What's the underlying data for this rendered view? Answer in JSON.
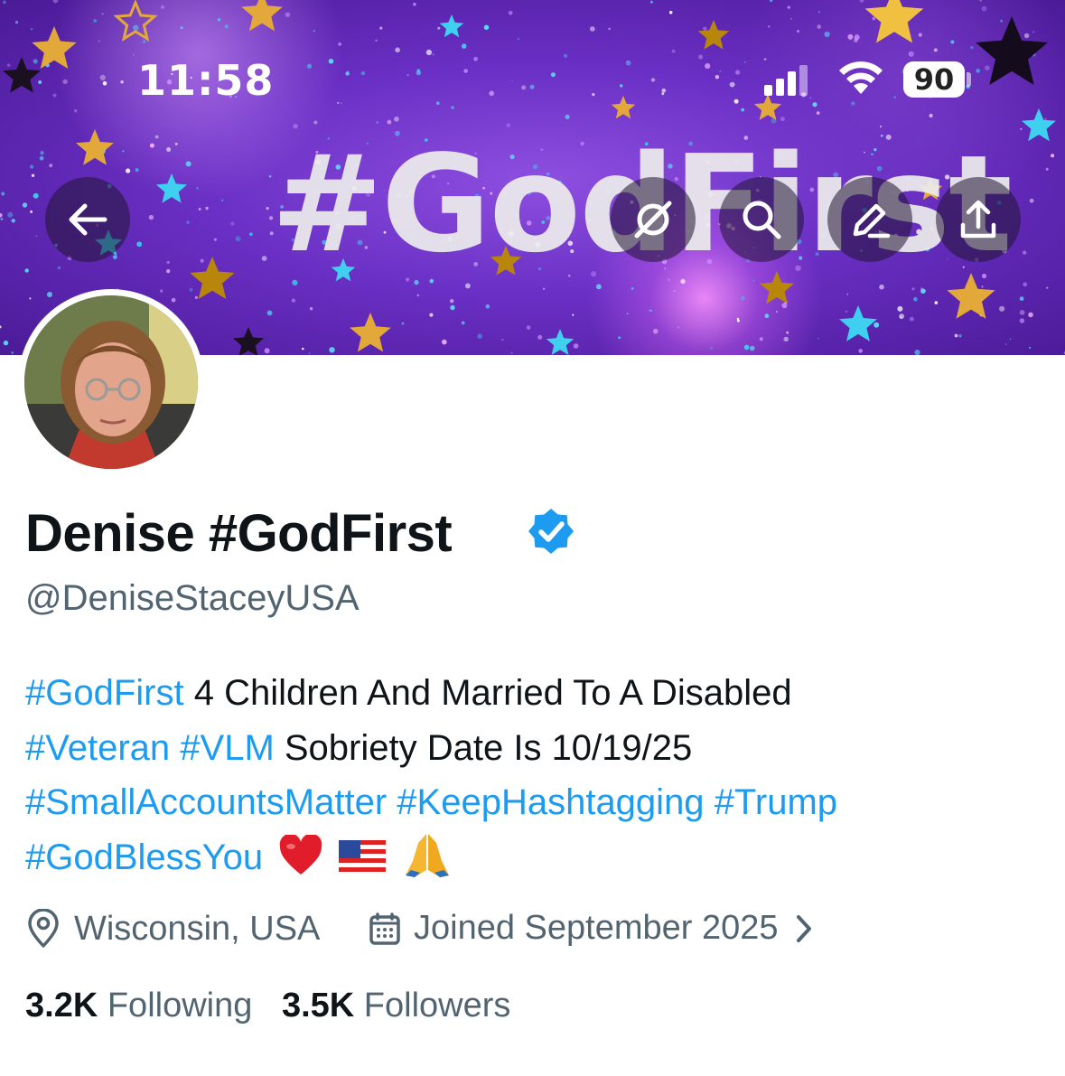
{
  "status_bar": {
    "time": "11:58",
    "battery": "90",
    "icons": [
      "cellular-signal-icon",
      "wifi-icon",
      "battery-icon"
    ]
  },
  "banner": {
    "text": "#GodFirst",
    "colors": {
      "base": "#6a2fc4",
      "highlight": "#e98cff",
      "star_gold": "#e2a93a",
      "star_cyan": "#39c6ea"
    }
  },
  "header_buttons": {
    "icons": [
      "back-arrow-icon",
      "grok-icon",
      "search-icon",
      "edit-icon",
      "share-icon"
    ]
  },
  "profile": {
    "display_name": "Denise #GodFirst",
    "verified": true,
    "handle": "@DeniseStaceyUSA",
    "bio": [
      [
        {
          "text": "#GodFirst",
          "tag": true
        },
        {
          "text": " 4 Children And Married To A Disabled",
          "tag": false
        }
      ],
      [
        {
          "text": "#Veteran",
          "tag": true
        },
        {
          "text": " ",
          "tag": false
        },
        {
          "text": "#VLM",
          "tag": true
        },
        {
          "text": " Sobriety Date Is 10/19/25",
          "tag": false
        }
      ],
      [
        {
          "text": "#SmallAccountsMatter",
          "tag": true
        },
        {
          "text": " ",
          "tag": false
        },
        {
          "text": "#KeepHashtagging",
          "tag": true
        },
        {
          "text": " ",
          "tag": false
        },
        {
          "text": "#Trump",
          "tag": true
        }
      ],
      [
        {
          "text": "#GodBlessYou",
          "tag": true
        }
      ]
    ],
    "bio_emojis": [
      "red-heart-emoji",
      "us-flag-emoji",
      "praying-hands-emoji"
    ],
    "location": "Wisconsin, USA",
    "joined": "Joined September 2025",
    "following_count": "3.2K",
    "following_label": "Following",
    "followers_count": "3.5K",
    "followers_label": "Followers"
  },
  "colors": {
    "link": "#1d9bf0",
    "text": "#0f1419",
    "secondary": "#536471",
    "verified": "#1d9bf0"
  }
}
